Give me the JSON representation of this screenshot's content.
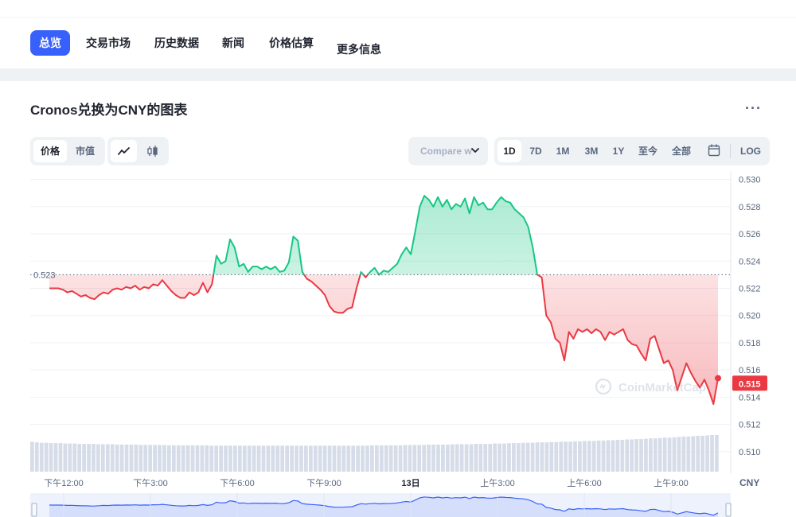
{
  "nav": {
    "items": [
      {
        "label": "总览",
        "active": true
      },
      {
        "label": "交易市场",
        "active": false
      },
      {
        "label": "历史数据",
        "active": false
      },
      {
        "label": "新闻",
        "active": false
      },
      {
        "label": "价格估算",
        "active": false
      },
      {
        "label": "更多信息",
        "active": false
      }
    ]
  },
  "chart_header": {
    "title": "Cronos兑换为CNY的图表",
    "more_icon": "more-horizontal-icon",
    "metric_tabs": [
      "价格",
      "市值"
    ],
    "chart_type_icons": [
      "line-chart-icon",
      "candlestick-icon"
    ],
    "compare_placeholder": "Compare w",
    "range_tabs": [
      "1D",
      "7D",
      "1M",
      "3M",
      "1Y",
      "至今",
      "全部"
    ],
    "calendar_icon": "calendar-icon",
    "log_label": "LOG",
    "active_range": "1D",
    "active_metric": "价格"
  },
  "colors": {
    "accent": "#3861fb",
    "up": "#16c784",
    "down": "#ea3943",
    "grid": "#eff2f5",
    "axis_text": "#58667e"
  },
  "chart_data": {
    "type": "line",
    "title": "",
    "xlabel": "",
    "ylabel": "",
    "currency_label": "CNY",
    "watermark": "CoinMarketCap",
    "ylim": [
      0.509,
      0.5305
    ],
    "y_ticks": [
      0.53,
      0.528,
      0.526,
      0.524,
      0.522,
      0.52,
      0.518,
      0.516,
      0.514,
      0.512,
      0.51
    ],
    "x_tick_labels": [
      "下午12:00",
      "下午3:00",
      "下午6:00",
      "下午9:00",
      "13日",
      "上午3:00",
      "上午6:00",
      "上午9:00"
    ],
    "reference_value": 0.523,
    "reference_label": "0.523",
    "current_value": 0.515,
    "current_label": "0.515",
    "series": [
      {
        "values": [
          0.522,
          0.522,
          0.522,
          0.5219,
          0.5217,
          0.5218,
          0.5216,
          0.5214,
          0.5215,
          0.5213,
          0.5212,
          0.5215,
          0.5217,
          0.5216,
          0.5219,
          0.522,
          0.5219,
          0.5221,
          0.522,
          0.5222,
          0.5219,
          0.5221,
          0.522,
          0.5223,
          0.5222,
          0.5226,
          0.5222,
          0.5218,
          0.5215,
          0.5213,
          0.5213,
          0.5217,
          0.5215,
          0.5217,
          0.5224,
          0.5217,
          0.5223,
          0.5244,
          0.5238,
          0.524,
          0.5256,
          0.525,
          0.5236,
          0.5238,
          0.5232,
          0.5236,
          0.5236,
          0.5234,
          0.5236,
          0.5234,
          0.5236,
          0.5232,
          0.5233,
          0.5239,
          0.5258,
          0.5255,
          0.5232,
          0.5227,
          0.5225,
          0.5222,
          0.5219,
          0.5215,
          0.5207,
          0.5203,
          0.5202,
          0.5202,
          0.5205,
          0.5206,
          0.522,
          0.5232,
          0.5228,
          0.5232,
          0.5235,
          0.523,
          0.5233,
          0.5232,
          0.5235,
          0.5238,
          0.5245,
          0.525,
          0.5245,
          0.5262,
          0.528,
          0.5288,
          0.5285,
          0.528,
          0.5287,
          0.528,
          0.5285,
          0.5278,
          0.5282,
          0.528,
          0.5286,
          0.5275,
          0.5287,
          0.5281,
          0.5283,
          0.5278,
          0.5278,
          0.5283,
          0.5287,
          0.5284,
          0.5283,
          0.5278,
          0.5275,
          0.5272,
          0.5265,
          0.525,
          0.523,
          0.5228,
          0.52,
          0.5195,
          0.5183,
          0.518,
          0.5167,
          0.5188,
          0.5183,
          0.519,
          0.5188,
          0.519,
          0.5187,
          0.519,
          0.5188,
          0.5182,
          0.5188,
          0.5186,
          0.5188,
          0.519,
          0.5182,
          0.5179,
          0.5178,
          0.5172,
          0.5167,
          0.5183,
          0.5185,
          0.5175,
          0.5165,
          0.5167,
          0.516,
          0.5145,
          0.5155,
          0.5165,
          0.5158,
          0.5152,
          0.5147,
          0.5153,
          0.5145,
          0.5135,
          0.5154
        ]
      }
    ],
    "volume_relative": [
      0.82,
      0.8,
      0.79,
      0.79,
      0.78,
      0.78,
      0.78,
      0.77,
      0.77,
      0.77,
      0.76,
      0.76,
      0.76,
      0.76,
      0.75,
      0.75,
      0.75,
      0.75,
      0.74,
      0.74,
      0.74,
      0.74,
      0.74,
      0.73,
      0.73,
      0.73,
      0.73,
      0.73,
      0.73,
      0.72,
      0.72,
      0.72,
      0.72,
      0.72,
      0.72,
      0.72,
      0.72,
      0.72,
      0.71,
      0.71,
      0.71,
      0.71,
      0.71,
      0.71,
      0.71,
      0.71,
      0.71,
      0.71,
      0.71,
      0.71,
      0.71,
      0.71,
      0.71,
      0.71,
      0.71,
      0.71,
      0.71,
      0.71,
      0.71,
      0.71,
      0.71,
      0.71,
      0.71,
      0.71,
      0.71,
      0.71,
      0.71,
      0.71,
      0.71,
      0.71,
      0.71,
      0.71,
      0.72,
      0.72,
      0.72,
      0.72,
      0.72,
      0.72,
      0.72,
      0.73,
      0.73,
      0.73,
      0.73,
      0.73,
      0.74,
      0.74,
      0.74,
      0.74,
      0.74,
      0.75,
      0.75,
      0.75,
      0.75,
      0.75,
      0.76,
      0.76,
      0.76,
      0.76,
      0.77,
      0.77,
      0.77,
      0.78,
      0.78,
      0.78,
      0.79,
      0.79,
      0.79,
      0.8,
      0.8,
      0.8,
      0.81,
      0.81,
      0.82,
      0.82,
      0.82,
      0.83,
      0.83,
      0.84,
      0.84,
      0.84,
      0.85,
      0.85,
      0.86,
      0.86,
      0.87,
      0.87,
      0.88,
      0.88,
      0.89,
      0.89,
      0.9,
      0.91,
      0.91,
      0.92,
      0.93,
      0.93,
      0.94,
      0.95,
      0.96,
      0.96,
      0.97,
      0.98,
      0.98,
      0.99,
      1.0,
      1.0
    ],
    "grid": true,
    "legend": "none"
  }
}
